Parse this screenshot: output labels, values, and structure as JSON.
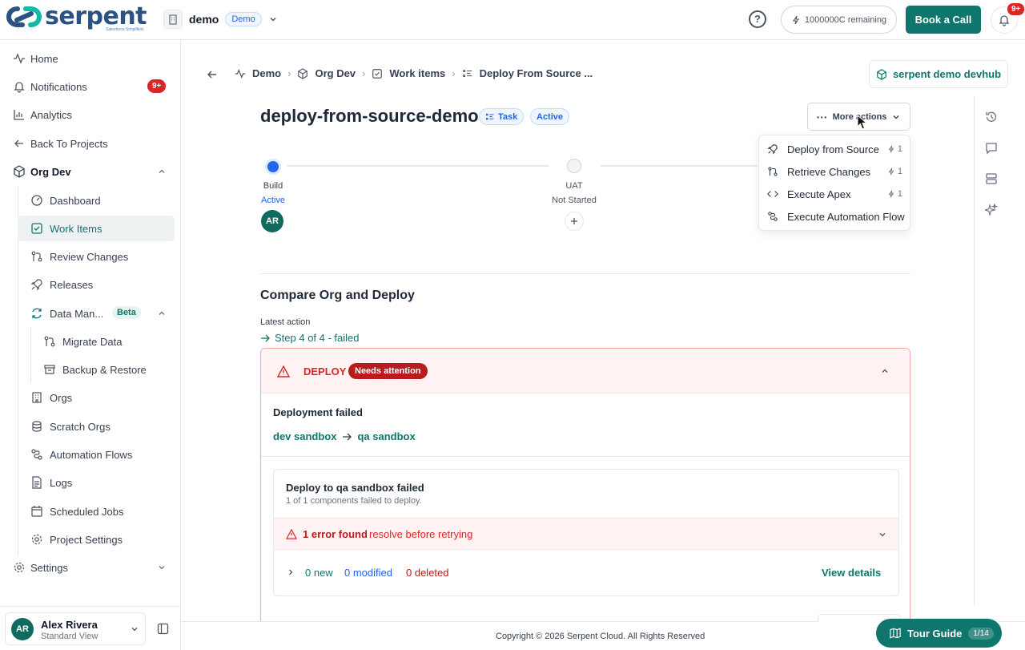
{
  "topbar": {
    "logo_text": "serpent",
    "logo_tagline": "Salesforce Simplified.",
    "project_name": "demo",
    "project_badge": "Demo",
    "credits": "1000000C remaining",
    "book_call": "Book a Call",
    "notif_count": "9+"
  },
  "sidebar": {
    "home": "Home",
    "notifications": "Notifications",
    "notifications_count": "9+",
    "analytics": "Analytics",
    "back": "Back To Projects",
    "org_dev": "Org Dev",
    "dashboard": "Dashboard",
    "work_items": "Work Items",
    "review_changes": "Review Changes",
    "releases": "Releases",
    "data_man": "Data Man...",
    "beta": "Beta",
    "migrate": "Migrate Data",
    "backup": "Backup & Restore",
    "orgs": "Orgs",
    "scratch": "Scratch Orgs",
    "automation": "Automation Flows",
    "logs": "Logs",
    "scheduled": "Scheduled Jobs",
    "project_settings": "Project Settings",
    "settings": "Settings"
  },
  "user": {
    "initials": "AR",
    "name": "Alex Rivera",
    "view": "Standard View"
  },
  "breadcrumb": {
    "demo": "Demo",
    "org_dev": "Org Dev",
    "work_items": "Work items",
    "current": "Deploy From Source ..."
  },
  "devhub": "serpent demo devhub",
  "work_item": {
    "title": "deploy-from-source-demo",
    "type": "Task",
    "status": "Active"
  },
  "more_actions": "More actions",
  "menu": [
    {
      "label": "Deploy from Source",
      "count": "1"
    },
    {
      "label": "Retrieve Changes",
      "count": "1"
    },
    {
      "label": "Execute Apex",
      "count": "1"
    },
    {
      "label": "Execute Automation Flow",
      "count": ""
    }
  ],
  "pipeline": {
    "build": {
      "name": "Build",
      "status": "Active",
      "assignee": "AR"
    },
    "uat": {
      "name": "UAT",
      "status": "Not Started"
    }
  },
  "compare": {
    "heading": "Compare Org and Deploy",
    "latest_label": "Latest action",
    "latest_link": "Step 4 of 4 - failed",
    "deploy_label": "DEPLOY",
    "attention": "Needs attention",
    "failed": "Deployment failed",
    "source": "dev sandbox",
    "target": "qa sandbox",
    "inner_title": "Deploy to qa sandbox failed",
    "inner_sub": "1 of 1 components failed to deploy.",
    "error_count": "1 error found",
    "error_hint": "resolve before retrying",
    "new": "0 new",
    "modified": "0 modified",
    "deleted": "0 deleted",
    "view_details": "View details"
  },
  "footer": "Copyright © 2026 Serpent Cloud. All Rights Reserved",
  "tour": {
    "label": "Tour Guide",
    "count": "1/14"
  },
  "colors": {
    "brand": "#0f766e",
    "danger": "#dc2626",
    "primary_blue": "#2563eb"
  }
}
